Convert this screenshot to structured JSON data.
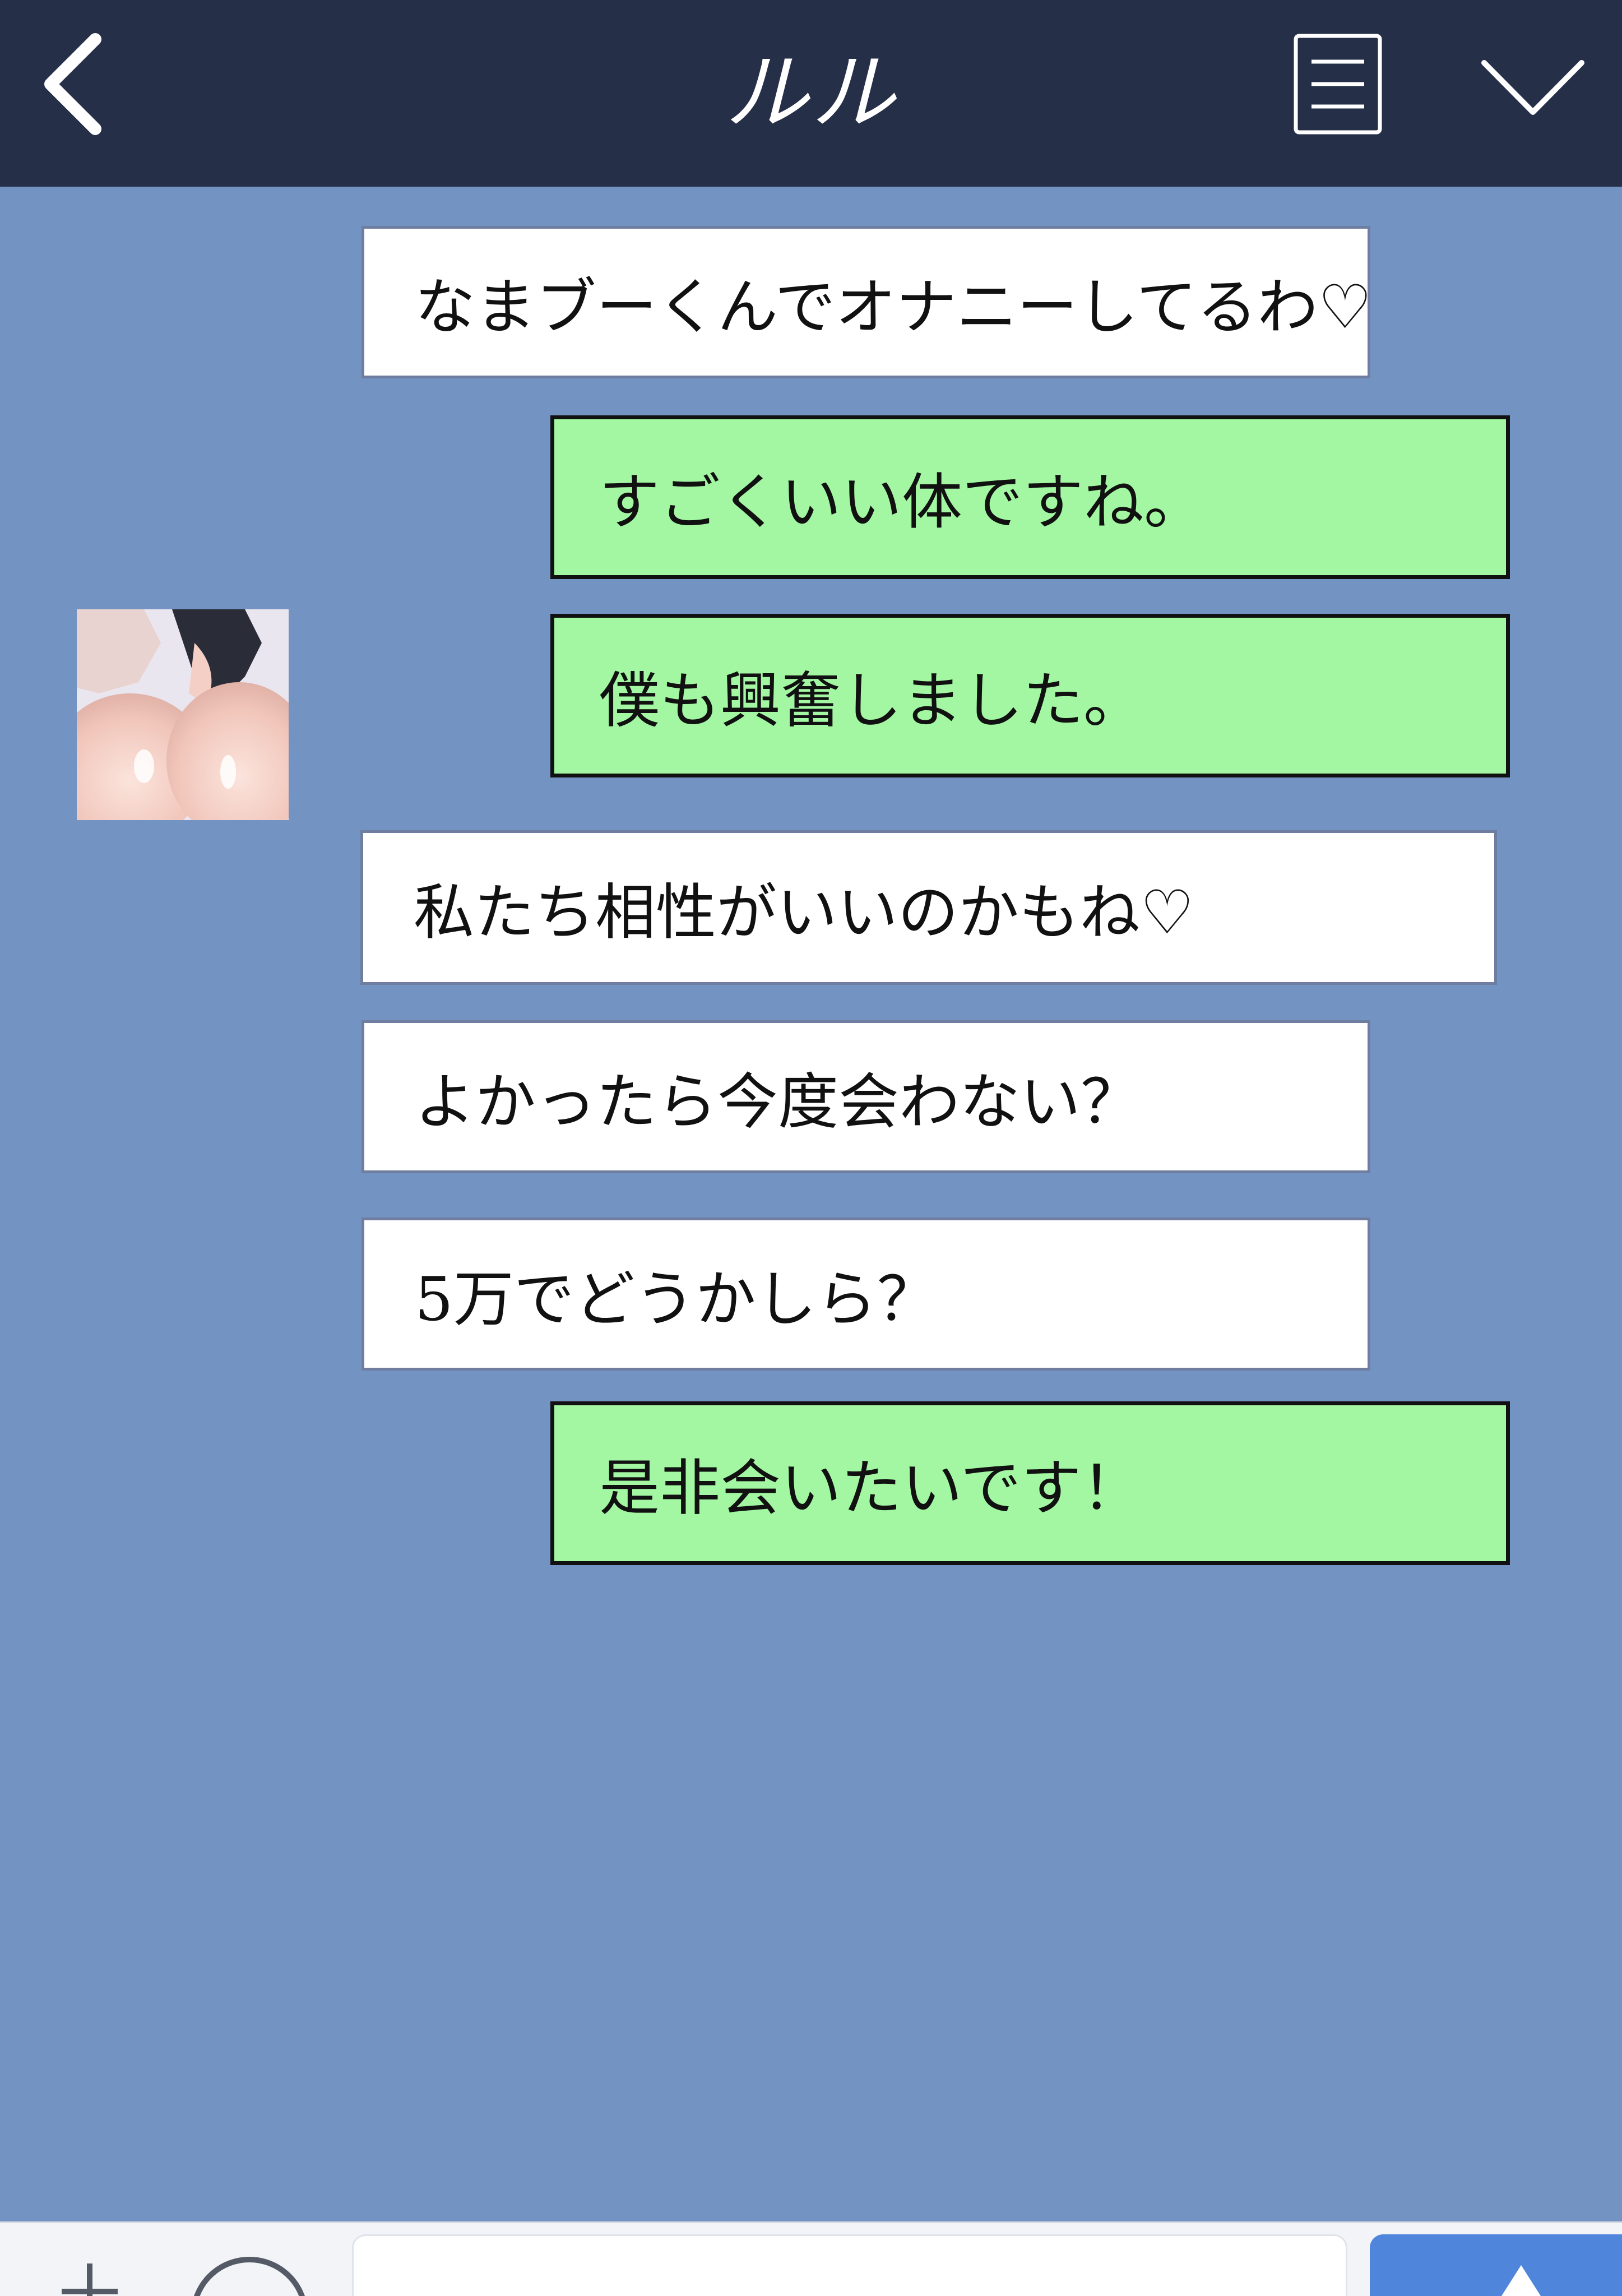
{
  "header": {
    "title": "ルル",
    "back_icon": "chevron-left-icon",
    "menu_icon": "menu-list-icon",
    "collapse_icon": "chevron-down-icon",
    "background": "#262f48"
  },
  "chat": {
    "background": "#7393c2",
    "contact_avatar": "avatar-image",
    "messages": [
      {
        "sender": "contact",
        "text": "なまブーくんでオナニーしてるわ♡"
      },
      {
        "sender": "me",
        "text": "すごくいい体ですね。"
      },
      {
        "sender": "me",
        "text": "僕も興奮しました。"
      },
      {
        "sender": "contact",
        "text": "私たち相性がいいのかもね♡"
      },
      {
        "sender": "contact",
        "text": "よかったら今度会わない？"
      },
      {
        "sender": "contact",
        "text": "5万でどうかしら？"
      },
      {
        "sender": "me",
        "text": "是非会いたいです！"
      }
    ]
  },
  "colors": {
    "incoming_bubble": "#ffffff",
    "outgoing_bubble": "#a3f7a3",
    "send_button": "#4f86dc"
  },
  "bottom_bar": {
    "plus_icon": "plus-icon",
    "emoji_icon": "smiley-icon",
    "input_value": "",
    "send_icon": "send-icon"
  }
}
